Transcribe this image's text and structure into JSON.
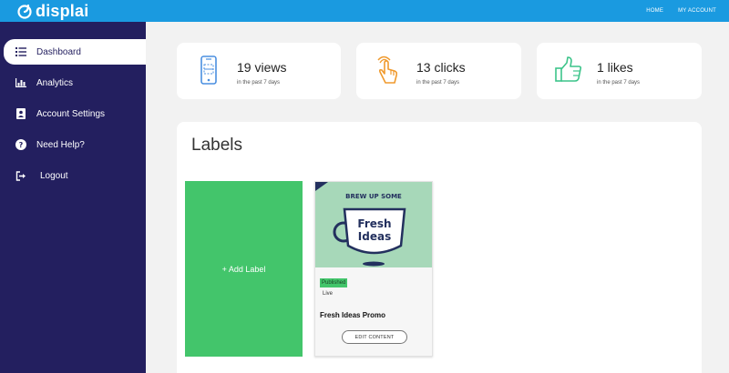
{
  "app": {
    "brand": "displai",
    "accent": "#1a9ae0",
    "sidebar_bg": "#231f5f"
  },
  "topnav": {
    "home": "HOME",
    "account": "MY ACCOUNT"
  },
  "sidebar": {
    "items": [
      {
        "label": "Dashboard",
        "icon": "list-icon",
        "active": true
      },
      {
        "label": "Analytics",
        "icon": "bar-chart-icon",
        "active": false
      },
      {
        "label": "Account Settings",
        "icon": "contact-card-icon",
        "active": false
      },
      {
        "label": "Need Help?",
        "icon": "question-circle-icon",
        "active": false
      },
      {
        "label": "Logout",
        "icon": "sign-out-icon",
        "active": false
      }
    ]
  },
  "stats": [
    {
      "value": "19 views",
      "caption": "in the past 7 days",
      "icon": "phone-scan-icon",
      "color": "#4a8fe0"
    },
    {
      "value": "13 clicks",
      "caption": "in the past 7 days",
      "icon": "tap-hand-icon",
      "color": "#f09a2e"
    },
    {
      "value": "1 likes",
      "caption": "in the past 7 days",
      "icon": "thumbs-up-icon",
      "color": "#3cc48a"
    }
  ],
  "labels": {
    "title": "Labels",
    "add_label": "+ Add Label",
    "cards": [
      {
        "status": "Published",
        "substatus": "Live",
        "name": "Fresh Ideas Promo",
        "edit_label": "EDIT CONTENT",
        "image": {
          "top_text": "BREW UP SOME",
          "main_line1": "Fresh",
          "main_line2": "Ideas"
        }
      }
    ]
  }
}
